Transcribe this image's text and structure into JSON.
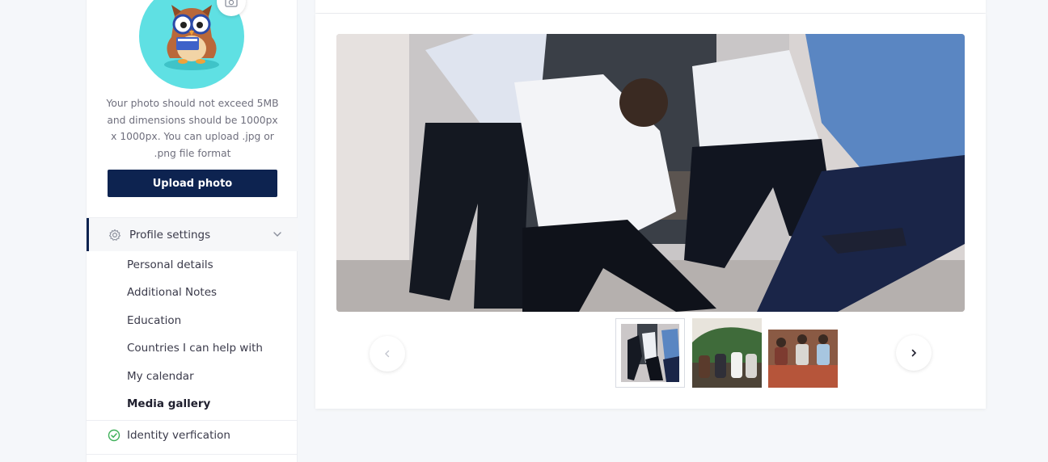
{
  "sidebar": {
    "upload_hint": "Your photo should not exceed 5MB and dimensions should be 1000px x 1000px. You can upload .jpg or .png file format",
    "upload_button": "Upload photo",
    "profile_settings_label": "Profile settings",
    "sub_items": [
      {
        "label": "Personal details",
        "active": false
      },
      {
        "label": "Additional Notes",
        "active": false
      },
      {
        "label": "Education",
        "active": false
      },
      {
        "label": "Countries I can help with",
        "active": false
      },
      {
        "label": "My calendar",
        "active": false
      },
      {
        "label": "Media gallery",
        "active": true
      }
    ],
    "identity_label": "Identity verfication"
  },
  "gallery": {
    "thumbnails": [
      "friends-jumping-photo",
      "friends-on-hill-photo",
      "friends-sitting-photo"
    ],
    "selected_index": 0
  },
  "colors": {
    "brand_navy": "#0d2350",
    "avatar_bg": "#5fe0e3",
    "verified_green": "#3fb05a"
  },
  "icons": {
    "gear": "gear-icon",
    "chevron": "chevron-down-icon",
    "check": "check-circle-icon",
    "camera": "camera-icon",
    "prev": "chevron-left-icon",
    "next": "chevron-right-icon"
  }
}
